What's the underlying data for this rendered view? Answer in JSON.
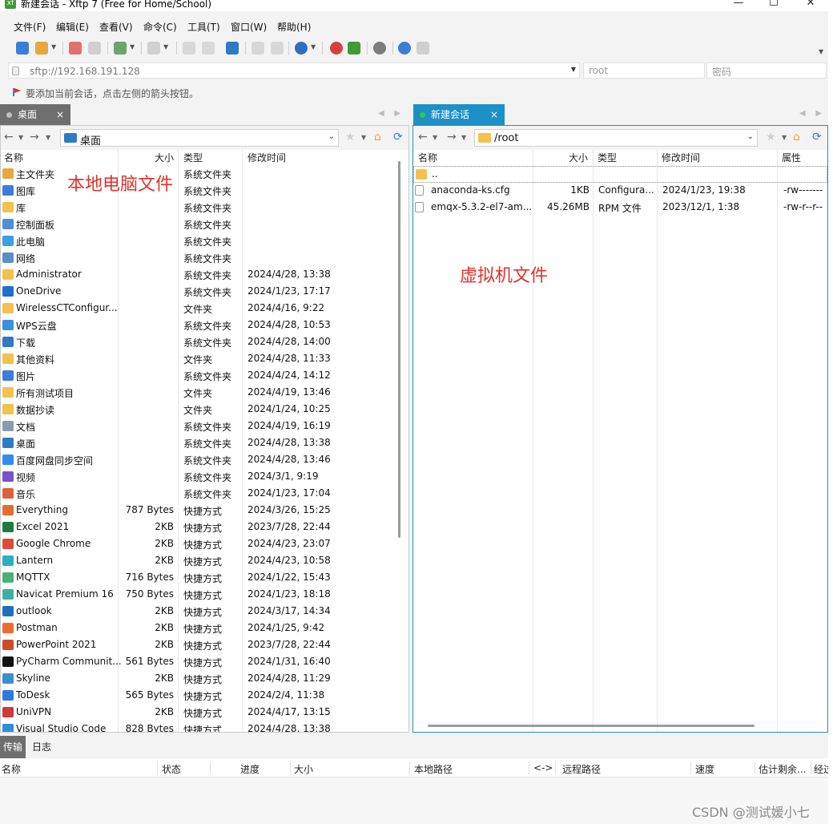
{
  "window": {
    "title": "新建会话 - Xftp 7 (Free for Home/School)",
    "app_icon_text": "xf"
  },
  "menu": [
    "文件(F)",
    "编辑(E)",
    "查看(V)",
    "命令(C)",
    "工具(T)",
    "窗口(W)",
    "帮助(H)"
  ],
  "address": {
    "value": "sftp://192.168.191.128",
    "user_value": "root",
    "password_placeholder": "密码"
  },
  "hint": "要添加当前会话，点击左侧的箭头按钮。",
  "left_tab": {
    "label": "桌面",
    "close": "×"
  },
  "right_tab": {
    "label": "新建会话",
    "close": "×"
  },
  "left_path": "桌面",
  "right_path": "/root",
  "left_columns": [
    "名称",
    "大小",
    "类型",
    "修改时间"
  ],
  "right_columns": [
    "名称",
    "大小",
    "类型",
    "修改时间",
    "属性"
  ],
  "left_files": [
    {
      "name": "主文件夹",
      "size": "",
      "type": "系统文件夹",
      "date": "",
      "icon": "home"
    },
    {
      "name": "图库",
      "size": "",
      "type": "系统文件夹",
      "date": "",
      "icon": "image"
    },
    {
      "name": "库",
      "size": "",
      "type": "系统文件夹",
      "date": "",
      "icon": "folder"
    },
    {
      "name": "控制面板",
      "size": "",
      "type": "系统文件夹",
      "date": "",
      "icon": "control"
    },
    {
      "name": "此电脑",
      "size": "",
      "type": "系统文件夹",
      "date": "",
      "icon": "pc"
    },
    {
      "name": "网络",
      "size": "",
      "type": "系统文件夹",
      "date": "",
      "icon": "network"
    },
    {
      "name": "Administrator",
      "size": "",
      "type": "系统文件夹",
      "date": "2024/4/28, 13:38",
      "icon": "folder"
    },
    {
      "name": "OneDrive",
      "size": "",
      "type": "系统文件夹",
      "date": "2024/1/23, 17:17",
      "icon": "cloud"
    },
    {
      "name": "WirelessCTConfigur...",
      "size": "",
      "type": "文件夹",
      "date": "2024/4/16, 9:22",
      "icon": "folder"
    },
    {
      "name": "WPS云盘",
      "size": "",
      "type": "系统文件夹",
      "date": "2024/4/28, 10:53",
      "icon": "wps"
    },
    {
      "name": "下载",
      "size": "",
      "type": "系统文件夹",
      "date": "2024/4/28, 14:00",
      "icon": "download"
    },
    {
      "name": "其他资料",
      "size": "",
      "type": "文件夹",
      "date": "2024/4/28, 11:33",
      "icon": "folder"
    },
    {
      "name": "图片",
      "size": "",
      "type": "系统文件夹",
      "date": "2024/4/24, 14:12",
      "icon": "image"
    },
    {
      "name": "所有测试项目",
      "size": "",
      "type": "文件夹",
      "date": "2024/4/19, 13:46",
      "icon": "folder"
    },
    {
      "name": "数据抄读",
      "size": "",
      "type": "文件夹",
      "date": "2024/1/24, 10:25",
      "icon": "folder"
    },
    {
      "name": "文档",
      "size": "",
      "type": "系统文件夹",
      "date": "2024/4/19, 16:19",
      "icon": "doc"
    },
    {
      "name": "桌面",
      "size": "",
      "type": "系统文件夹",
      "date": "2024/4/28, 13:38",
      "icon": "desktop"
    },
    {
      "name": "百度网盘同步空间",
      "size": "",
      "type": "系统文件夹",
      "date": "2024/4/28, 13:46",
      "icon": "baidu"
    },
    {
      "name": "视频",
      "size": "",
      "type": "系统文件夹",
      "date": "2024/3/1, 9:19",
      "icon": "video"
    },
    {
      "name": "音乐",
      "size": "",
      "type": "系统文件夹",
      "date": "2024/1/23, 17:04",
      "icon": "music"
    },
    {
      "name": "Everything",
      "size": "787 Bytes",
      "type": "快捷方式",
      "date": "2024/3/26, 15:25",
      "icon": "everything"
    },
    {
      "name": "Excel 2021",
      "size": "2KB",
      "type": "快捷方式",
      "date": "2023/7/28, 22:44",
      "icon": "excel"
    },
    {
      "name": "Google Chrome",
      "size": "2KB",
      "type": "快捷方式",
      "date": "2024/4/23, 23:07",
      "icon": "chrome"
    },
    {
      "name": "Lantern",
      "size": "2KB",
      "type": "快捷方式",
      "date": "2024/4/23, 10:58",
      "icon": "lantern"
    },
    {
      "name": "MQTTX",
      "size": "716 Bytes",
      "type": "快捷方式",
      "date": "2024/1/22, 15:43",
      "icon": "mqttx"
    },
    {
      "name": "Navicat Premium 16",
      "size": "750 Bytes",
      "type": "快捷方式",
      "date": "2024/1/23, 18:18",
      "icon": "navicat"
    },
    {
      "name": "outlook",
      "size": "2KB",
      "type": "快捷方式",
      "date": "2024/3/17, 14:34",
      "icon": "outlook"
    },
    {
      "name": "Postman",
      "size": "2KB",
      "type": "快捷方式",
      "date": "2024/1/25, 9:42",
      "icon": "postman"
    },
    {
      "name": "PowerPoint 2021",
      "size": "2KB",
      "type": "快捷方式",
      "date": "2023/7/28, 22:44",
      "icon": "ppt"
    },
    {
      "name": "PyCharm Communit...",
      "size": "561 Bytes",
      "type": "快捷方式",
      "date": "2024/1/31, 16:40",
      "icon": "pycharm"
    },
    {
      "name": "Skyline",
      "size": "2KB",
      "type": "快捷方式",
      "date": "2024/4/28, 11:29",
      "icon": "skyline"
    },
    {
      "name": "ToDesk",
      "size": "565 Bytes",
      "type": "快捷方式",
      "date": "2024/2/4, 11:38",
      "icon": "todesk"
    },
    {
      "name": "UniVPN",
      "size": "2KB",
      "type": "快捷方式",
      "date": "2024/4/17, 13:15",
      "icon": "univpn"
    },
    {
      "name": "Visual Studio Code",
      "size": "828 Bytes",
      "type": "快捷方式",
      "date": "2024/4/28, 13:38",
      "icon": "vscode"
    }
  ],
  "right_files": [
    {
      "name": "..",
      "size": "",
      "type": "",
      "date": "",
      "attr": "",
      "icon": "folder"
    },
    {
      "name": "anaconda-ks.cfg",
      "size": "1KB",
      "type": "Configura...",
      "date": "2024/1/23, 19:38",
      "attr": "-rw-------",
      "icon": "cfg"
    },
    {
      "name": "emqx-5.3.2-el7-am...",
      "size": "45.26MB",
      "type": "RPM 文件",
      "date": "2023/12/1, 1:38",
      "attr": "-rw-r--r--",
      "icon": "file"
    }
  ],
  "annotations": {
    "left": "本地电脑文件",
    "right": "虚拟机文件"
  },
  "bottom_tabs": [
    "传输",
    "日志"
  ],
  "transfer_columns": [
    "名称",
    "状态",
    "进度",
    "大小",
    "本地路径",
    "<->",
    "远程路径",
    "速度",
    "估计剩余...",
    "经过"
  ],
  "watermark": "CSDN @测试媛小七",
  "colors": {
    "tab_active": "#1e90c8",
    "tab_inactive": "#6e6e6e",
    "folder": "#f2c14e",
    "annotation": "#e0322b",
    "session_dot": "#2ecc40"
  }
}
